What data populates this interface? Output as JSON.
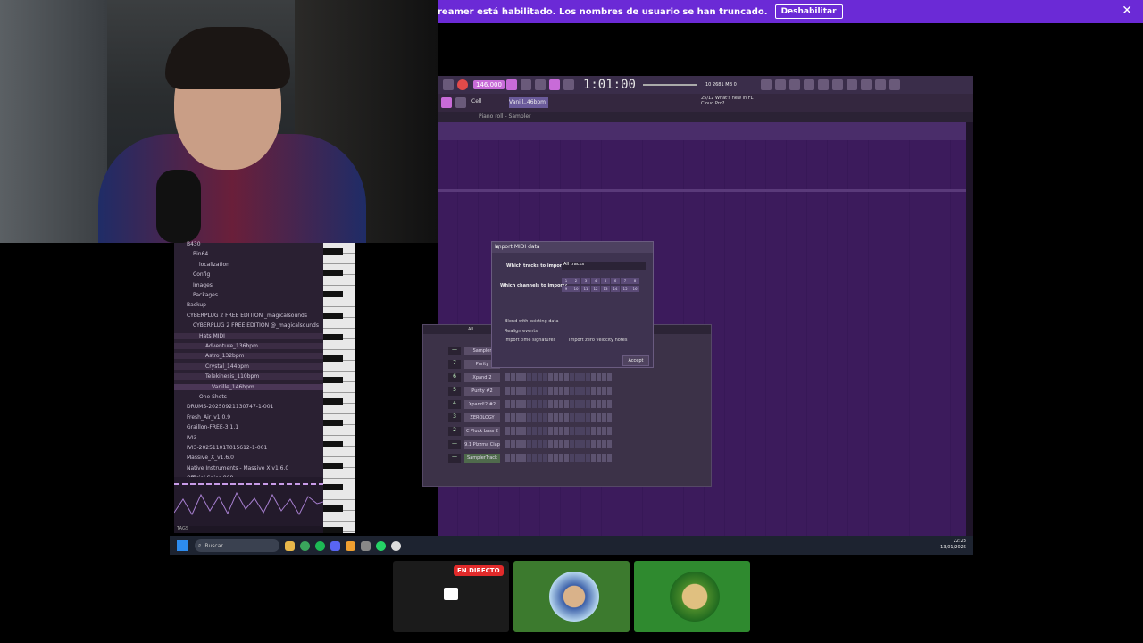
{
  "notification": {
    "message": "reamer está habilitado. Los nombres de usuario se han truncado.",
    "button": "Deshabilitar",
    "close": "✕"
  },
  "fl": {
    "tempo": "146.000",
    "time": "1:01:00",
    "cpu_mb": "2681 MB",
    "cpu_val": "10",
    "cpu_zero": "0",
    "news": "25/12  What's new in FL Cloud Pro?",
    "snap": "Cell",
    "pattern": "Vanill..46bpm",
    "piano_roll_title": "Piano roll - Sampler"
  },
  "browser": {
    "items": [
      {
        "label": "B430",
        "indent": 0
      },
      {
        "label": "Bin64",
        "indent": 1
      },
      {
        "label": "localization",
        "indent": 2
      },
      {
        "label": "Config",
        "indent": 1
      },
      {
        "label": "Images",
        "indent": 1
      },
      {
        "label": "Packages",
        "indent": 1
      },
      {
        "label": "Backup",
        "indent": 0
      },
      {
        "label": "CYBERPLUG 2 FREE EDITION _magicalsounds",
        "indent": 0
      },
      {
        "label": "CYBERPLUG 2 FREE EDITION @_magicalsounds",
        "indent": 1
      },
      {
        "label": "Hats MIDI",
        "indent": 2
      },
      {
        "label": "Adventure_136bpm",
        "indent": 3
      },
      {
        "label": "Astro_132bpm",
        "indent": 3
      },
      {
        "label": "Crystal_144bpm",
        "indent": 3
      },
      {
        "label": "Telekinesis_110bpm",
        "indent": 3
      },
      {
        "label": "Vanille_146bpm",
        "indent": 4
      },
      {
        "label": "One Shots",
        "indent": 2
      },
      {
        "label": "DRUMS-20250921130747-1-001",
        "indent": 0
      },
      {
        "label": "Fresh_Air_v1.0.9",
        "indent": 0
      },
      {
        "label": "Graillon-FREE-3.1.1",
        "indent": 0
      },
      {
        "label": "IVI3",
        "indent": 0
      },
      {
        "label": "IVI3-20251101T015612-1-001",
        "indent": 0
      },
      {
        "label": "Massive_X_v1.6.0",
        "indent": 0
      },
      {
        "label": "Native Instruments - Massive X v1.6.0",
        "indent": 0
      },
      {
        "label": "Official Spice 808",
        "indent": 0
      }
    ],
    "tags": "TAGS"
  },
  "rack": {
    "filter": "All",
    "rows": [
      {
        "num": "—",
        "name": "Sampler"
      },
      {
        "num": "7",
        "name": "Purity"
      },
      {
        "num": "6",
        "name": "Xpand!2"
      },
      {
        "num": "5",
        "name": "Purity #2"
      },
      {
        "num": "4",
        "name": "Xpand!2 #2"
      },
      {
        "num": "3",
        "name": "ZEROLOGY"
      },
      {
        "num": "2",
        "name": "C Pluck bass 2"
      },
      {
        "num": "—",
        "name": "9.1 Plzzma Clap"
      },
      {
        "num": "—",
        "name": "SamplerTrack"
      }
    ]
  },
  "midi": {
    "title": "Import MIDI data",
    "tracks_label": "Which tracks to import?",
    "tracks_value": "All tracks",
    "channels_label": "Which channels to import?",
    "channels": [
      "1",
      "2",
      "3",
      "4",
      "5",
      "6",
      "7",
      "8",
      "9",
      "10",
      "11",
      "12",
      "13",
      "14",
      "15",
      "16"
    ],
    "opt1": "Blend with existing data",
    "opt2": "Realign events",
    "opt3": "Import time signatures",
    "opt4": "Import zero velocity notes",
    "accept": "Accept"
  },
  "taskbar": {
    "search": "Buscar",
    "time": "22:23",
    "date": "13/01/2026"
  },
  "call": {
    "live": "EN DIRECTO"
  },
  "colors": {
    "accent": "#6b2ad6",
    "live": "#e12a2a"
  }
}
